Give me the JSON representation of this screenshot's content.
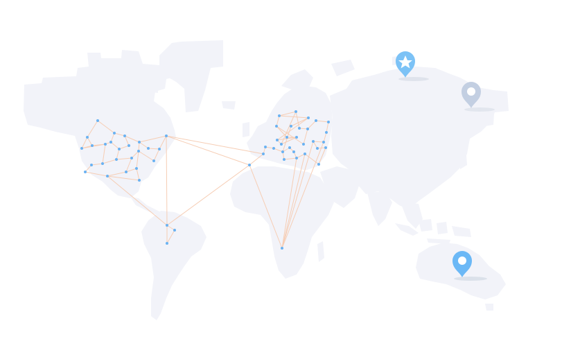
{
  "map": {
    "land_color": "#f2f3f9",
    "line_color": "#f6cdb4",
    "node_color": "#6ab2f2"
  },
  "markers": [
    {
      "name": "star-pin-icon",
      "color": "#7cc2f6",
      "glyph": "star"
    },
    {
      "name": "location-pin-icon-grey",
      "color": "#c3cfe2",
      "glyph": "dot"
    },
    {
      "name": "location-pin-icon-blue",
      "color": "#6bb8f6",
      "glyph": "dot"
    }
  ]
}
